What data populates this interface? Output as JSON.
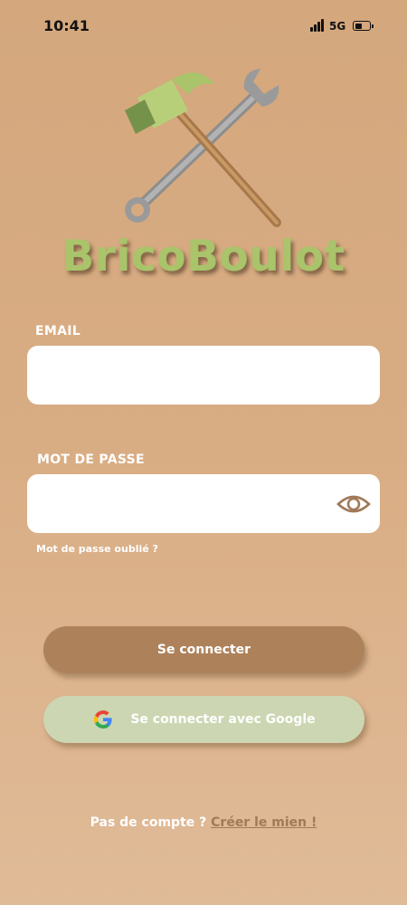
{
  "status_bar": {
    "time": "10:41",
    "network": "5G",
    "battery_level": 0.55
  },
  "app": {
    "title": "BricoBoulot",
    "logo_icon": "hammer-wrench-logo-icon"
  },
  "form": {
    "email_label": "EMAIL",
    "email_value": "",
    "password_label": "MOT DE PASSE",
    "password_value": "",
    "toggle_icon": "eye-icon",
    "forgot_link": "Mot de passe oublié ?"
  },
  "actions": {
    "login_label": "Se connecter",
    "google_label": "Se connecter avec Google",
    "google_icon": "google-icon"
  },
  "signup": {
    "prompt": "Pas de compte ? ",
    "link": "Créer le mien !"
  },
  "colors": {
    "background": "#d6aa80",
    "title_green": "#a9c46a",
    "login_button": "#ad825b",
    "google_button": "#ccd6b2",
    "link_brown": "#a07a58"
  }
}
